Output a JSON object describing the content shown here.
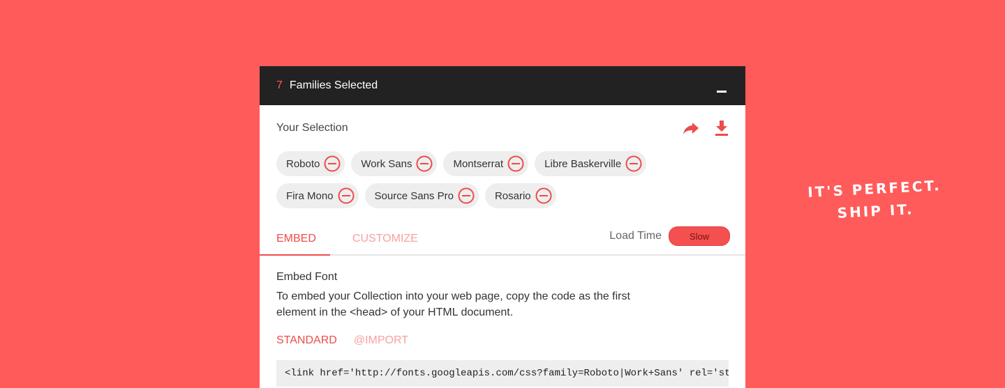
{
  "header": {
    "count": "7",
    "families_label": "Families Selected"
  },
  "selection": {
    "title": "Your Selection",
    "icons": [
      "share-icon",
      "download-icon"
    ],
    "fonts": [
      "Roboto",
      "Work Sans",
      "Montserrat",
      "Libre Baskerville",
      "Fira Mono",
      "Source Sans Pro",
      "Rosario"
    ]
  },
  "tabs": {
    "embed": "EMBED",
    "customize": "CUSTOMIZE"
  },
  "load_time": {
    "label": "Load Time",
    "value": "Slow"
  },
  "embed": {
    "title": "Embed Font",
    "description": "To embed your Collection into your web page, copy the code as the first element in the <head> of your HTML document.",
    "subtabs": {
      "standard": "STANDARD",
      "import": "@IMPORT"
    },
    "code": "<link href='http://fonts.googleapis.com/css?family=Roboto|Work+Sans' rel='styleshe"
  },
  "handwriting": {
    "line1": "IT'S PERFECT.",
    "line2": "SHIP IT."
  },
  "colors": {
    "background": "#FF5B5B",
    "header": "#222222",
    "accent": "#EE4B4B"
  }
}
